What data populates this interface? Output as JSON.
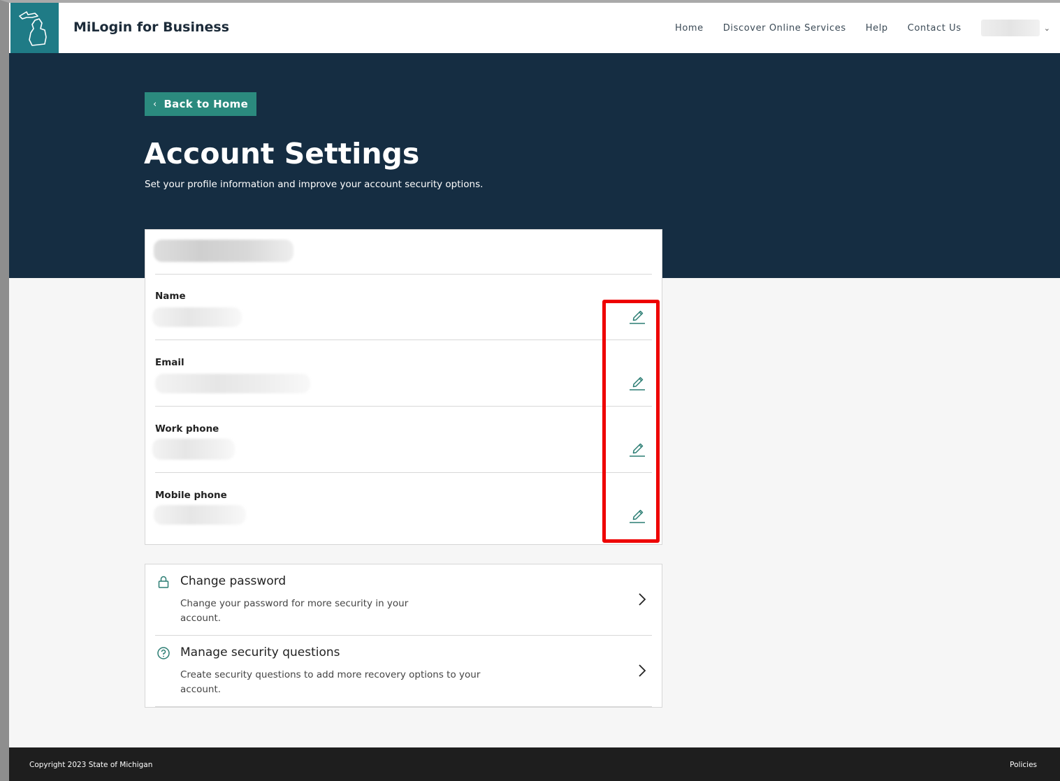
{
  "header": {
    "brand": "MiLogin for Business",
    "nav": [
      "Home",
      "Discover Online Services",
      "Help",
      "Contact Us"
    ],
    "user_caret": "⌄"
  },
  "hero": {
    "back_label": "Back to Home",
    "back_chevron": "‹",
    "title": "Account Settings",
    "subtitle": "Set your profile information and improve your account security options."
  },
  "profile": {
    "fields": [
      {
        "label": "Name"
      },
      {
        "label": "Email"
      },
      {
        "label": "Work phone"
      },
      {
        "label": "Mobile phone"
      }
    ]
  },
  "security": {
    "items": [
      {
        "title": "Change password",
        "description": "Change your password for more security in your account.",
        "icon": "lock-icon"
      },
      {
        "title": "Manage security questions",
        "description": "Create security questions to add more recovery options to your account.",
        "icon": "question-circle-icon"
      }
    ]
  },
  "footer": {
    "copyright": "Copyright 2023 State of Michigan",
    "policies": "Policies"
  },
  "colors": {
    "hero_bg": "#152d42",
    "accent_teal": "#2b8a7e",
    "logo_bg": "#1f7b86",
    "highlight": "#ee0000",
    "footer_bg": "#1e1e1e"
  }
}
